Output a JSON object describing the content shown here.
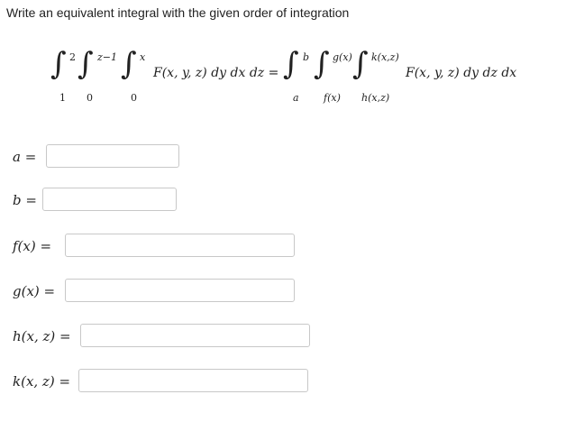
{
  "prompt": "Write an equivalent integral with the given order of integration",
  "formula": {
    "lhs": {
      "outer": {
        "lower": "1",
        "upper": "2"
      },
      "middle": {
        "lower": "0",
        "upper": "z−1"
      },
      "inner": {
        "lower": "0",
        "upper": "x"
      },
      "integrand": "F(x, y, z) dy dx dz ="
    },
    "rhs": {
      "outer": {
        "lower": "a",
        "upper": "b"
      },
      "middle": {
        "lower": "f(x)",
        "upper": "g(x)"
      },
      "inner": {
        "lower": "h(x,z)",
        "upper": "k(x,z)"
      },
      "integrand": "F(x, y, z) dy dz dx"
    }
  },
  "fields": [
    {
      "label": "a",
      "eq": "=",
      "value": ""
    },
    {
      "label": "b",
      "eq": "=",
      "value": ""
    },
    {
      "label": "f(x)",
      "eq": "=",
      "value": ""
    },
    {
      "label": "g(x)",
      "eq": "=",
      "value": ""
    },
    {
      "label": "h(x, z)",
      "eq": "=",
      "value": ""
    },
    {
      "label": "k(x, z)",
      "eq": "=",
      "value": ""
    }
  ]
}
